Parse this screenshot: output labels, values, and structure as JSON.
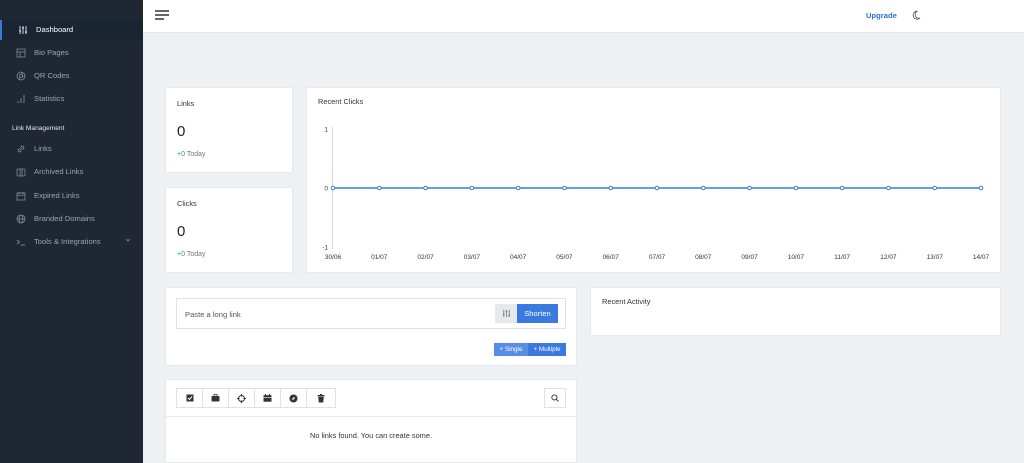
{
  "sidebar": {
    "items": [
      {
        "label": "Dashboard",
        "icon": "sliders-icon"
      },
      {
        "label": "Bio Pages",
        "icon": "layout-icon"
      },
      {
        "label": "QR Codes",
        "icon": "qr-aperture-icon"
      },
      {
        "label": "Statistics",
        "icon": "bar-chart-icon"
      }
    ],
    "section_title": "Link Management",
    "link_items": [
      {
        "label": "Links",
        "icon": "link-icon"
      },
      {
        "label": "Archived Links",
        "icon": "archive-icon"
      },
      {
        "label": "Expired Links",
        "icon": "calendar-icon"
      },
      {
        "label": "Branded Domains",
        "icon": "globe-icon"
      },
      {
        "label": "Tools & Integrations",
        "icon": "terminal-icon"
      }
    ]
  },
  "header": {
    "upgrade_label": "Upgrade"
  },
  "stats": {
    "links": {
      "title": "Links",
      "value": "0",
      "delta": "+0",
      "period": "Today"
    },
    "clicks": {
      "title": "Clicks",
      "value": "0",
      "delta": "+0",
      "period": "Today"
    }
  },
  "chart_data": {
    "type": "line",
    "title": "Recent Clicks",
    "categories": [
      "30/06",
      "01/07",
      "02/07",
      "03/07",
      "04/07",
      "05/07",
      "06/07",
      "07/07",
      "08/07",
      "09/07",
      "10/07",
      "11/07",
      "12/07",
      "13/07",
      "14/07"
    ],
    "values": [
      0,
      0,
      0,
      0,
      0,
      0,
      0,
      0,
      0,
      0,
      0,
      0,
      0,
      0,
      0
    ],
    "yticks": [
      "1",
      "0",
      "-1"
    ],
    "ylim": [
      -1,
      1
    ],
    "color": "#3a7ae0"
  },
  "shorten": {
    "placeholder": "Paste a long link",
    "button_label": "Shorten",
    "single_label": "+ Single",
    "multiple_label": "+ Multiple"
  },
  "recent_activity": {
    "title": "Recent Activity"
  },
  "links_table": {
    "empty_message": "No links found. You can create some."
  },
  "colors": {
    "accent": "#3a7ae0",
    "sidebar_bg": "#1f2733",
    "positive": "#2aa44f"
  }
}
